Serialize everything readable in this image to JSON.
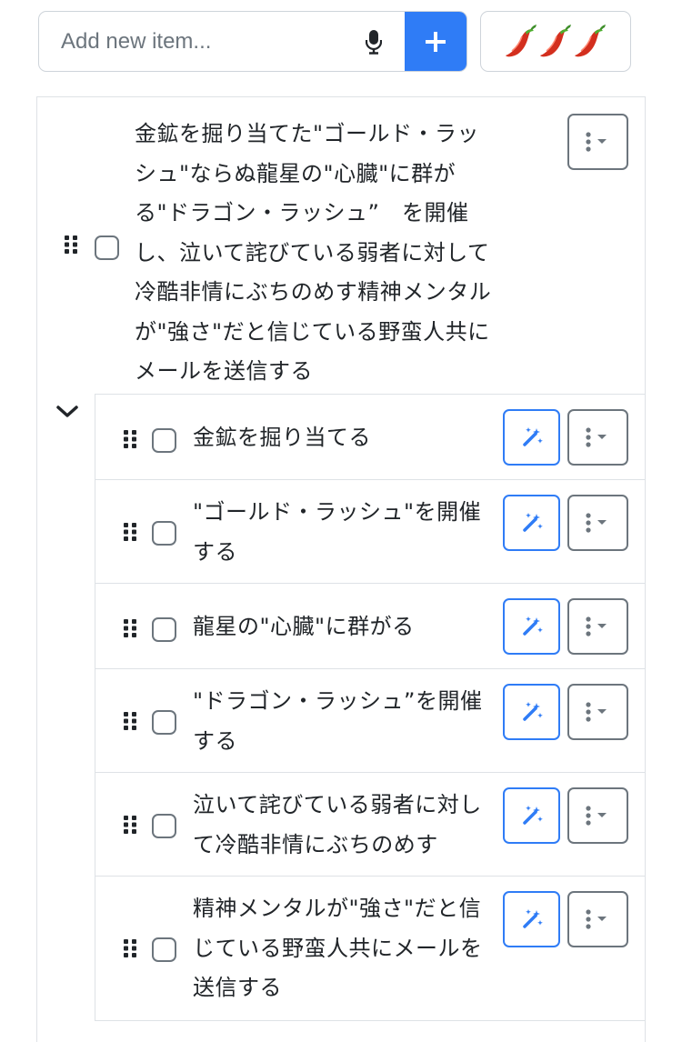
{
  "add_item": {
    "placeholder": "Add new item...",
    "mic_icon": "microphone-icon",
    "add_icon": "plus-icon",
    "spice_icon": "chili-pepper-icon",
    "spice_level": 3,
    "accent_color": "#2f7cf6"
  },
  "main_task": {
    "text": "金鉱を掘り当てた\"ゴールド・ラッシュ\"ならぬ龍星の\"心臓\"に群がる\"ドラゴン・ラッシュ”　を開催し、泣いて詫びている弱者に対して冷酷非情にぶちのめす精神メンタルが\"強さ\"だと信じている野蛮人共にメールを送信する",
    "checked": false
  },
  "subtasks": [
    {
      "text": "金鉱を掘り当てる",
      "checked": false
    },
    {
      "text": "\"ゴールド・ラッシュ\"を開催する",
      "checked": false
    },
    {
      "text": "龍星の\"心臓\"に群がる",
      "checked": false
    },
    {
      "text": "\"ドラゴン・ラッシュ”を開催する",
      "checked": false
    },
    {
      "text": "泣いて詫びている弱者に対して冷酷非情にぶちのめす",
      "checked": false
    },
    {
      "text": "精神メンタルが\"強さ\"だと信じている野蛮人共にメールを送信する",
      "checked": false
    }
  ]
}
